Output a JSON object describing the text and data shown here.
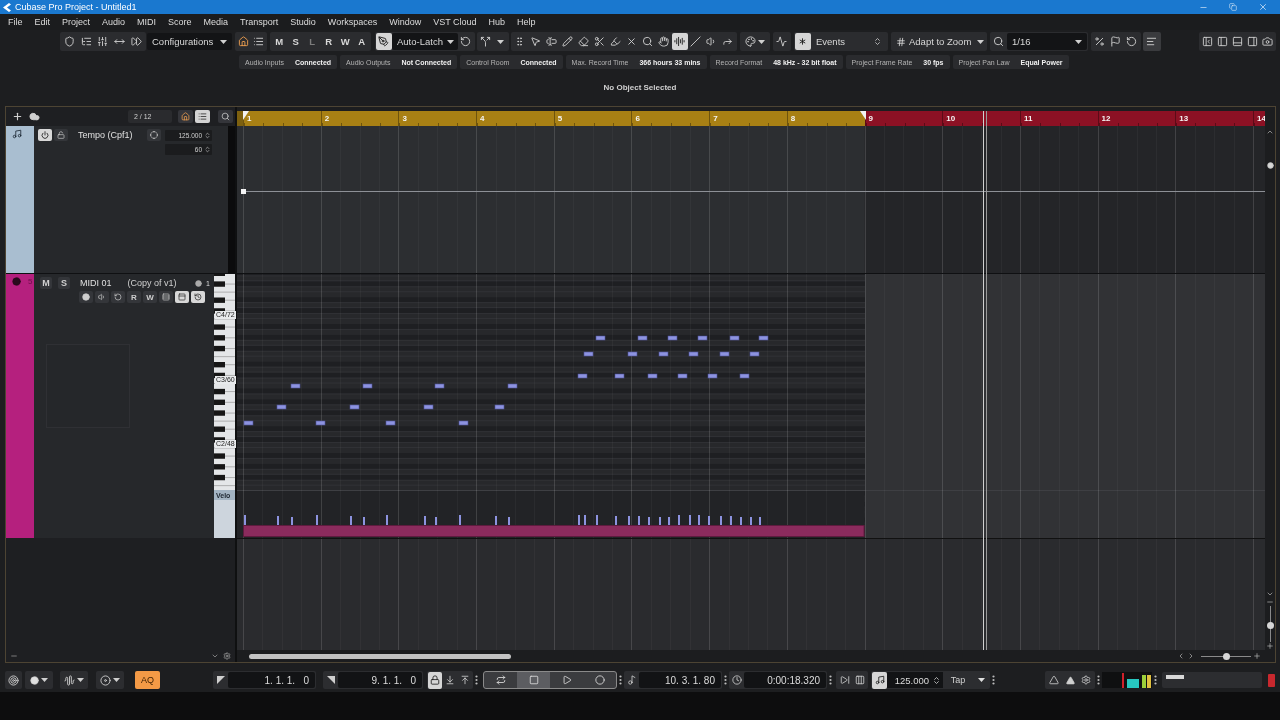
{
  "window": {
    "title": "Cubase Pro Project - Untitled1"
  },
  "menu": [
    "File",
    "Edit",
    "Project",
    "Audio",
    "MIDI",
    "Score",
    "Media",
    "Transport",
    "Studio",
    "Workspaces",
    "Window",
    "VST Cloud",
    "Hub",
    "Help"
  ],
  "toolbar": {
    "configurations": "Configurations",
    "automation_buttons": [
      {
        "label": "M",
        "disabled": false
      },
      {
        "label": "S",
        "disabled": false
      },
      {
        "label": "L",
        "disabled": true
      },
      {
        "label": "R",
        "disabled": false
      },
      {
        "label": "W",
        "disabled": false
      },
      {
        "label": "A",
        "disabled": false
      }
    ],
    "automation_mode": {
      "value": "Auto-Latch",
      "toggle_on": true
    },
    "tools": [
      {
        "kind": "grip",
        "selected": false
      },
      {
        "kind": "pointer",
        "selected": false
      },
      {
        "kind": "range",
        "selected": false
      },
      {
        "kind": "pencil",
        "selected": false
      },
      {
        "kind": "eraser",
        "selected": false
      },
      {
        "kind": "scissors",
        "selected": false
      },
      {
        "kind": "marker",
        "selected": false
      },
      {
        "kind": "mute",
        "selected": false
      },
      {
        "kind": "zoom",
        "selected": false
      },
      {
        "kind": "hand",
        "selected": false
      },
      {
        "kind": "comb",
        "selected": true
      },
      {
        "kind": "line",
        "selected": false
      },
      {
        "kind": "speaker",
        "selected": false
      },
      {
        "kind": "play",
        "selected": false
      }
    ],
    "snap": {
      "value": "Events",
      "on": true
    },
    "grid": {
      "value": "Adapt to Zoom"
    },
    "quantize": {
      "value": "1/16"
    }
  },
  "status_line": [
    {
      "label": "Audio Inputs",
      "value": "Connected"
    },
    {
      "label": "Audio Outputs",
      "value": "Not Connected"
    },
    {
      "label": "Control Room",
      "value": "Connected"
    },
    {
      "label": "Max. Record Time",
      "value": "366 hours 33 mins"
    },
    {
      "label": "Record Format",
      "value": "48 kHz - 32 bit float"
    },
    {
      "label": "Project Frame Rate",
      "value": "30 fps"
    },
    {
      "label": "Project Pan Law",
      "value": "Equal Power"
    }
  ],
  "info_line": "No Object Selected",
  "track_list": {
    "count": "2 / 12",
    "tracks": [
      {
        "kind": "tempo",
        "name": "Tempo (Cpf1)",
        "color": "#a9bed0",
        "active": true,
        "locked": false,
        "fields": [
          "125.000",
          "60"
        ]
      },
      {
        "kind": "midi",
        "number": "5",
        "name": "MIDI 01",
        "subtitle": "(Copy of v1)",
        "color": "#b5207e",
        "channel": "1",
        "mute": {
          "label": "M",
          "on": false
        },
        "solo": {
          "label": "S",
          "on": false
        },
        "buttons": [
          {
            "kind": "record",
            "on": false
          },
          {
            "kind": "monitor",
            "on": false
          },
          {
            "kind": "edit",
            "on": false
          },
          {
            "kind": "read",
            "label": "R",
            "on": false
          },
          {
            "kind": "write",
            "label": "W",
            "on": false
          },
          {
            "kind": "lanes",
            "on": false
          },
          {
            "kind": "panel",
            "on": true
          },
          {
            "kind": "history",
            "on": true
          }
        ],
        "keyboard_labels": [
          "C4/72",
          "C3/60",
          "C2/48"
        ],
        "lane_label": "Velo"
      }
    ]
  },
  "ruler": {
    "bars": [
      {
        "label": "1",
        "in_range": true
      },
      {
        "label": "2",
        "in_range": true
      },
      {
        "label": "3",
        "in_range": true
      },
      {
        "label": "4",
        "in_range": true
      },
      {
        "label": "5",
        "in_range": true
      },
      {
        "label": "6",
        "in_range": true
      },
      {
        "label": "7",
        "in_range": true
      },
      {
        "label": "8",
        "in_range": true
      },
      {
        "label": "9",
        "in_range": false
      },
      {
        "label": "10",
        "in_range": false
      },
      {
        "label": "11",
        "in_range": false
      },
      {
        "label": "12",
        "in_range": false
      },
      {
        "label": "13",
        "in_range": false
      },
      {
        "label": "14",
        "in_range": false
      }
    ]
  },
  "event_display": {
    "horizontal_zoom": {
      "level": 0.5
    },
    "vertical_zoom": {
      "level": 0.45
    }
  },
  "transport": {
    "auto_quantize": {
      "label": "AQ",
      "on": true
    },
    "left_locator": "1. 1. 1.   0",
    "right_locator": "9. 1. 1.   0",
    "lock_on": true,
    "controls": [
      {
        "kind": "cycle",
        "selected": false
      },
      {
        "kind": "stop",
        "selected": true
      },
      {
        "kind": "play",
        "selected": false
      },
      {
        "kind": "record",
        "selected": false
      }
    ],
    "primary_position": "10. 3. 1. 80",
    "secondary_position": "0:00:18.320",
    "tempo_track_on": true,
    "tempo": "125.000",
    "tap": "Tap",
    "performance": {
      "level": 0.2
    }
  }
}
